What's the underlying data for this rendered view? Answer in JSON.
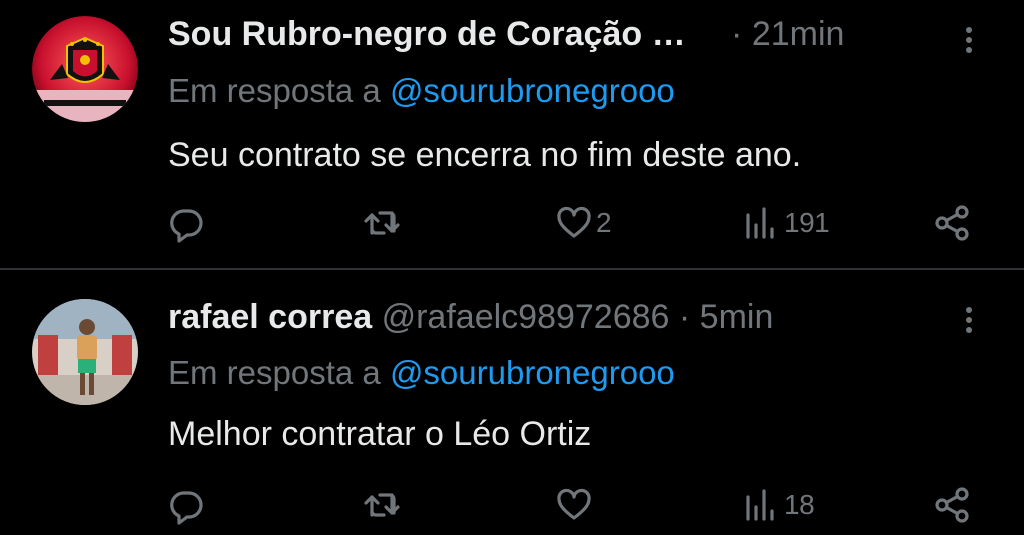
{
  "tweets": [
    {
      "display_name": "Sou Rubro-negro de Coração …",
      "handle": "",
      "separator": "·",
      "time": "21min",
      "reply_prefix": "Em resposta a",
      "reply_to": "@sourubronegrooo",
      "text": "Seu contrato se encerra no fim deste ano.",
      "likes": "2",
      "views": "191",
      "avatar": "club-crest-avatar"
    },
    {
      "display_name": "rafael correa",
      "handle": "@rafaelc98972686",
      "separator": "·",
      "time": "5min",
      "reply_prefix": "Em resposta a",
      "reply_to": "@sourubronegrooo",
      "text": "Melhor contratar o Léo Ortiz",
      "likes": "",
      "views": "18",
      "avatar": "user-photo-avatar"
    }
  ],
  "colors": {
    "background": "#000000",
    "text": "#e7e9ea",
    "muted": "#71767b",
    "link": "#1d9bf0",
    "divider": "#2f3336"
  },
  "icons": [
    "reply-icon",
    "retweet-icon",
    "like-icon",
    "views-icon",
    "share-icon",
    "more-icon"
  ]
}
